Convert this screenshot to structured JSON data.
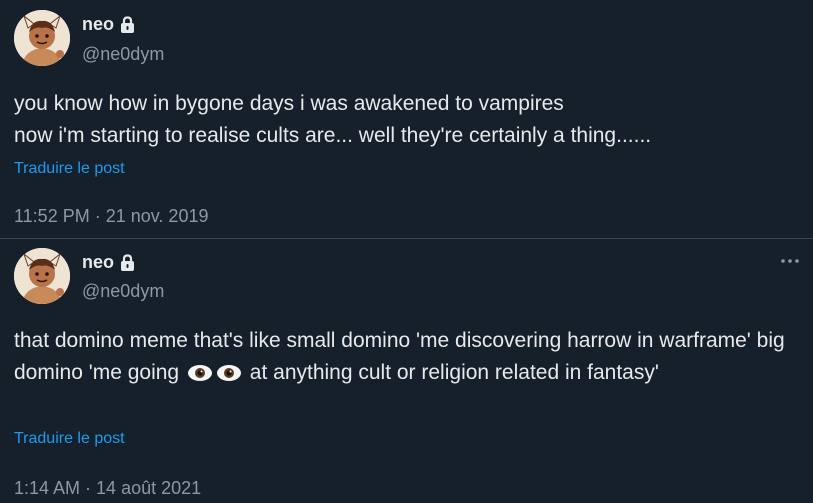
{
  "posts": [
    {
      "author": {
        "name": "neo",
        "handle": "@ne0dym",
        "avatar_icon": "avatar-icon",
        "protected_icon": "lock-icon"
      },
      "lines": [
        "you know how in bygone days i was awakened to vampires",
        "now i'm starting to realise cults are... well they're certainly a thing......"
      ],
      "translate_label": "Traduire le post",
      "time": "11:52 PM",
      "separator": " · ",
      "date": "21 nov. 2019"
    },
    {
      "author": {
        "name": "neo",
        "handle": "@ne0dym",
        "avatar_icon": "avatar-icon",
        "protected_icon": "lock-icon"
      },
      "text_before": "that domino meme that's like small domino 'me discovering harrow in warframe' big domino 'me going ",
      "emoji": [
        "eyes-emoji",
        "eyes-emoji"
      ],
      "text_after": " at anything cult or religion related in fantasy'",
      "translate_label": "Traduire le post",
      "more_icon": "more-options-icon",
      "time": "1:14 AM",
      "separator": " · ",
      "date": "14 août 2021"
    }
  ],
  "colors": {
    "background": "#15202b",
    "text": "#e7e9ea",
    "secondary": "#8b98a5",
    "link": "#1d9bf0",
    "divider": "#38444d"
  }
}
